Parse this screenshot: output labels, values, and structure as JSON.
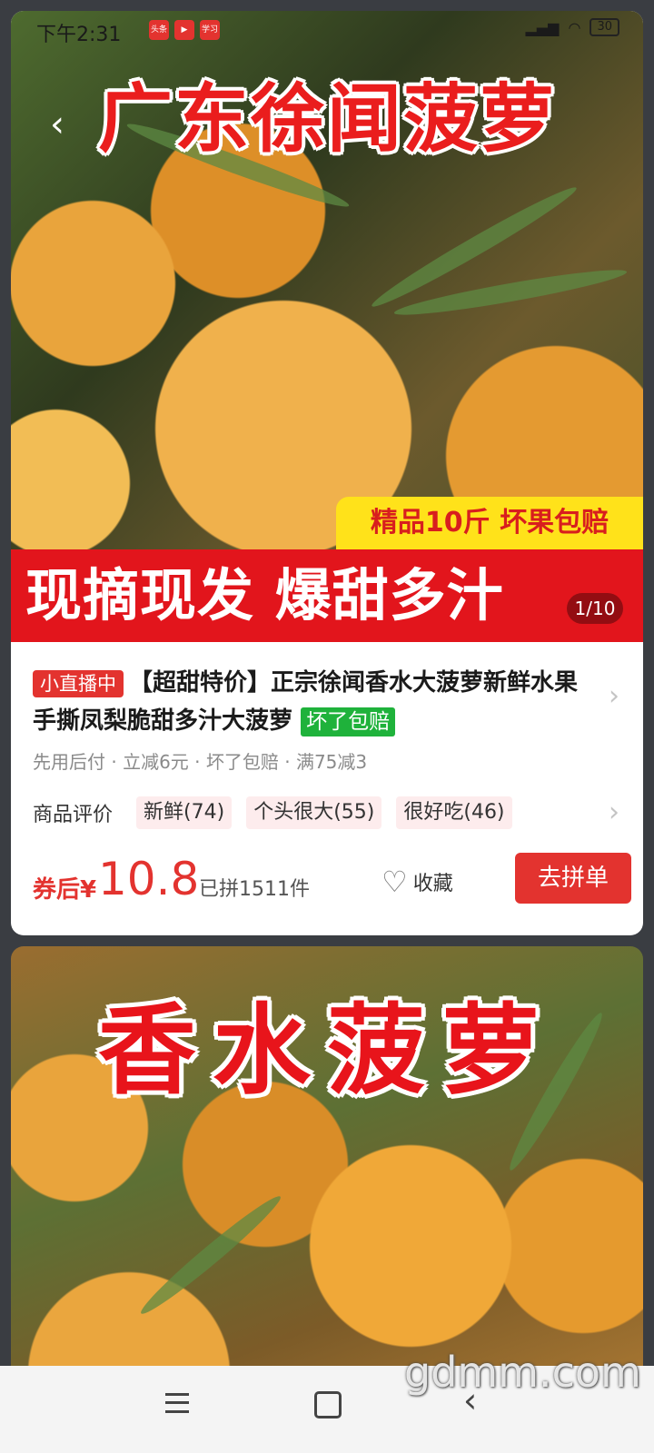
{
  "status_bar": {
    "time": "下午2:31",
    "app_icons": [
      "头条",
      "▶",
      "学习"
    ],
    "battery": "30"
  },
  "hero": {
    "title": "广东徐闻菠萝",
    "yellow_banner": "精品10斤 坏果包赔",
    "red_banner": "现摘现发 爆甜多汁",
    "image_counter": "1/10"
  },
  "product": {
    "live_tag": "小直播中",
    "title": "【超甜特价】正宗徐闻香水大菠萝新鲜水果手撕凤梨脆甜多汁大菠萝",
    "green_tag": "坏了包赔",
    "promos": "先用后付 · 立减6元 · 坏了包赔 · 满75减3",
    "review_label": "商品评价",
    "review_chips": [
      "新鲜(74)",
      "个头很大(55)",
      "很好吃(46)"
    ],
    "price_prefix": "券后¥",
    "price": "10.8",
    "sold": "已拼1511件",
    "favorite_label": "收藏",
    "buy_button": "去拼单"
  },
  "second_card": {
    "title": "香水菠萝"
  },
  "watermark": "gdmm.com",
  "colors": {
    "brand_red": "#e3332f",
    "green_tag": "#1fb23b",
    "banner_yellow": "#ffe21a"
  }
}
